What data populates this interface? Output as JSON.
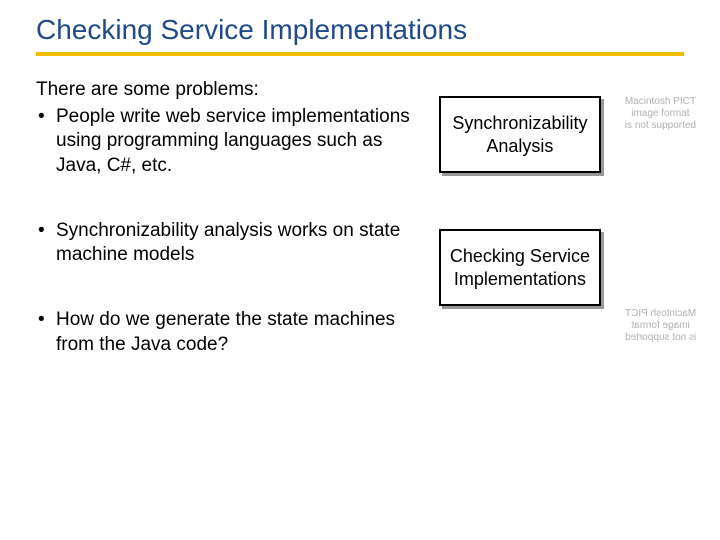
{
  "title": "Checking Service Implementations",
  "intro": "There are some problems:",
  "bullets": [
    "People write web service implementations using programming languages such as Java, C#, etc.",
    "Synchronizability analysis works on state machine models",
    "How do we generate the state machines from the Java code?"
  ],
  "boxes": {
    "top": "Synchronizability Analysis",
    "bottom": "Checking Service Implementations"
  },
  "placeholder": "Macintosh PICT\nimage format\nis not supported"
}
